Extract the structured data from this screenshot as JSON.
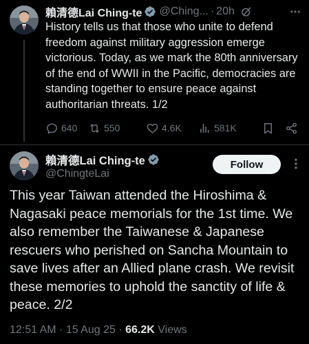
{
  "tweet1": {
    "author_name": "賴清德Lai Ching-te",
    "handle": "@Ching...",
    "separator": "·",
    "time": "20h",
    "text": "History tells us that those who unite to defend freedom against military aggression emerge victorious. Today, as we mark the 80th anniversary of the end of WWII in the Pacific, democracies are standing together to ensure peace against authoritarian threats. 1/2",
    "replies": "640",
    "reposts": "550",
    "likes": "4.6K",
    "views": "581K"
  },
  "tweet2": {
    "author_name": "賴清德Lai Ching-te",
    "handle": "@ChingteLai",
    "follow_label": "Follow",
    "text": "This year Taiwan attended the Hiroshima & Nagasaki peace memorials for the 1st time. We also remember the Taiwanese & Japanese rescuers who perished on Sancha Mountain to save lives after an Allied plane crash. We revisit these memories to uphold the sanctity of life & peace. 2/2",
    "timestamp": "12:51 AM · 15 Aug 25 · ",
    "views_count": "66.2K",
    "views_label": " Views"
  },
  "colors": {
    "background": "#000000",
    "text": "#e7e9ea",
    "muted": "#71767b",
    "verified": "#829aab",
    "follow_bg": "#eff3f4"
  }
}
